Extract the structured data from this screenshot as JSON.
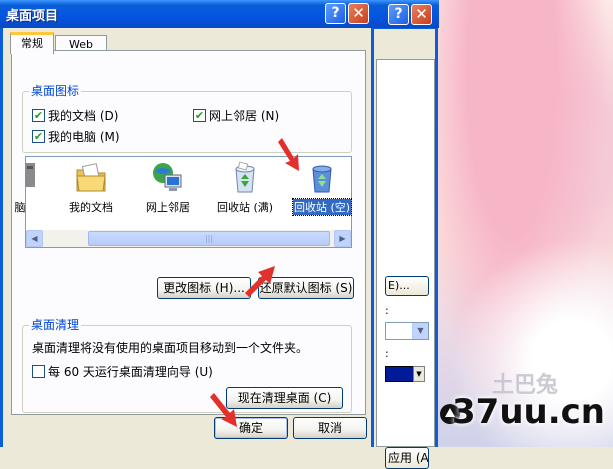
{
  "dialog": {
    "title": "桌面项目",
    "tabs": [
      {
        "label": "常规",
        "active": true
      },
      {
        "label": "Web",
        "active": false
      }
    ],
    "desktop_icons": {
      "legend": "桌面图标",
      "checkboxes": [
        {
          "label": "我的文档 (D)",
          "checked": true
        },
        {
          "label": "网上邻居 (N)",
          "checked": true
        },
        {
          "label": "我的电脑 (M)",
          "checked": true
        }
      ]
    },
    "icon_list": {
      "items": [
        {
          "label": "脑",
          "icon": "computer-icon"
        },
        {
          "label": "我的文档",
          "icon": "documents-folder-icon"
        },
        {
          "label": "网上邻居",
          "icon": "network-places-icon"
        },
        {
          "label": "回收站 (满)",
          "icon": "recycle-bin-full-icon"
        },
        {
          "label": "回收站 (空)",
          "icon": "recycle-bin-empty-icon",
          "selected": true
        }
      ]
    },
    "buttons": {
      "change_icon": "更改图标 (H)...",
      "restore_default": "还原默认图标 (S)"
    },
    "cleanup": {
      "legend": "桌面清理",
      "description": "桌面清理将没有使用的桌面项目移动到一个文件夹。",
      "checkbox_label": "每 60 天运行桌面清理向导 (U)",
      "checkbox_checked": false,
      "run_now": "现在清理桌面 (C)"
    },
    "ok": "确定",
    "cancel": "取消"
  },
  "background_window": {
    "button_fragment": "E)...",
    "apply_fragment": "应用 (A)",
    "tick_labels": [
      ":",
      ":"
    ]
  },
  "title_buttons": {
    "help": "?",
    "close": "✕"
  },
  "watermark": {
    "text": "37uu.cn",
    "logo_text": "土巴兔"
  },
  "colors": {
    "title_blue": "#0a5ed8",
    "selection": "#316ac5",
    "legend_text": "#0046d5",
    "annotation_red": "#e2302c"
  }
}
